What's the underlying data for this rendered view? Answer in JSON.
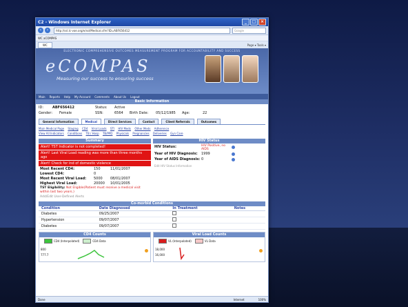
{
  "browser": {
    "title": "C2 - Windows Internet Explorer",
    "url": "http://ssl.lc-voe.org/e/ssl/Medical.cfm?ID=ABF656412",
    "search_placeholder": "Google",
    "links_label": "WC aCOMPAS",
    "tab_label": "WC",
    "tools": "Page ▾  Tools ▾",
    "status_left": "Done",
    "status_zone": "Internet",
    "status_zoom": "100%"
  },
  "banner": {
    "top_text": "ELECTRONIC COMPREHENSIVE OUTCOMES MEASUREMENT PROGRAM FOR ACCOUNTABILITY AND SUCCESS",
    "logo": "eCOMPAS",
    "tagline": "Measuring our success to ensuring success"
  },
  "appnav": [
    "Main",
    "Reports",
    "Help",
    "My Account",
    "Comments",
    "About Us",
    "Logout"
  ],
  "basic": {
    "header": "Basic Information",
    "id_label": "ID:",
    "id_value": "ABF656412",
    "status_label": "Status:",
    "status_value": "Active",
    "gender_label": "Gender:",
    "gender_value": "Female",
    "ssn_label": "SSN:",
    "ssn_value": "6564",
    "birth_label": "Birth Date:",
    "birth_value": "05/12/1985",
    "age_label": "Age:",
    "age_value": "22"
  },
  "tabs": [
    "General Information",
    "Medical",
    "Direct Services",
    "Contact",
    "Client Referrals",
    "Outcomes"
  ],
  "sublinks": [
    "Main Medical Page",
    "Staging",
    "CD4",
    "Viral Loads",
    "STI",
    "HIV Meds",
    "Other Meds",
    "Adherence",
    "View All Indicators",
    "Conditions",
    "TB / Hosp",
    "TB/PPD",
    "Physicals",
    "Pregnancies",
    "Deliveries",
    "Gyn Care"
  ],
  "summary": {
    "header": "Summary",
    "alerts": [
      "Alert! TST Indicator is not completed!",
      "Alert! Last Viral Load reading was more than three months ago",
      "Alert! Check for ind of domestic violence"
    ],
    "rows": [
      {
        "label": "Most Recent CD4:",
        "value": "150",
        "date": "11/01/2007"
      },
      {
        "label": "Lowest CD4:",
        "value": "0",
        "date": ""
      },
      {
        "label": "Most Recent Viral Load:",
        "value": "5000",
        "date": "08/01/2007"
      },
      {
        "label": "Highest Viral Load:",
        "value": "20000",
        "date": "10/01/2005"
      }
    ],
    "tst_label": "TST Eligibility:",
    "tst_value": "Not Eligible(Patient must receive a medical visit within last two years.)",
    "add_link": "Add/Edit User-Defined Alerts"
  },
  "hiv": {
    "header": "HIV Status",
    "status_label": "HIV Status:",
    "status_value": "HIV Positive, no AIDS",
    "diag_label": "Year of HIV Diagnosis:",
    "diag_value": "1999",
    "aids_label": "Year of AIDS Diagnosis:",
    "aids_value": "0",
    "edit_link": "Edit HIV Status Information"
  },
  "comorbid": {
    "header": "Co-morbid Conditions",
    "columns": [
      "Condition",
      "Date Diagnosed",
      "In Treatment",
      "Notes"
    ],
    "rows": [
      {
        "condition": "Diabetes",
        "date": "09/25/2007"
      },
      {
        "condition": "Hypertension",
        "date": "09/07/2007"
      },
      {
        "condition": "Diabetes",
        "date": "09/07/2007"
      }
    ]
  },
  "charts": {
    "cd4_header": "CD4 Counts",
    "cd4_legend": [
      "CD4 (Interpolated)",
      "CD4 Data"
    ],
    "cd4_axis": [
      "800",
      "777.7"
    ],
    "vl_header": "Viral Load Counts",
    "vl_legend": [
      "VL (Interpolated)",
      "VL Data"
    ],
    "vl_axis": [
      "18,000",
      "16,000"
    ],
    "cd4_color": "#3cc43c",
    "vl_color": "#d81d1d"
  }
}
